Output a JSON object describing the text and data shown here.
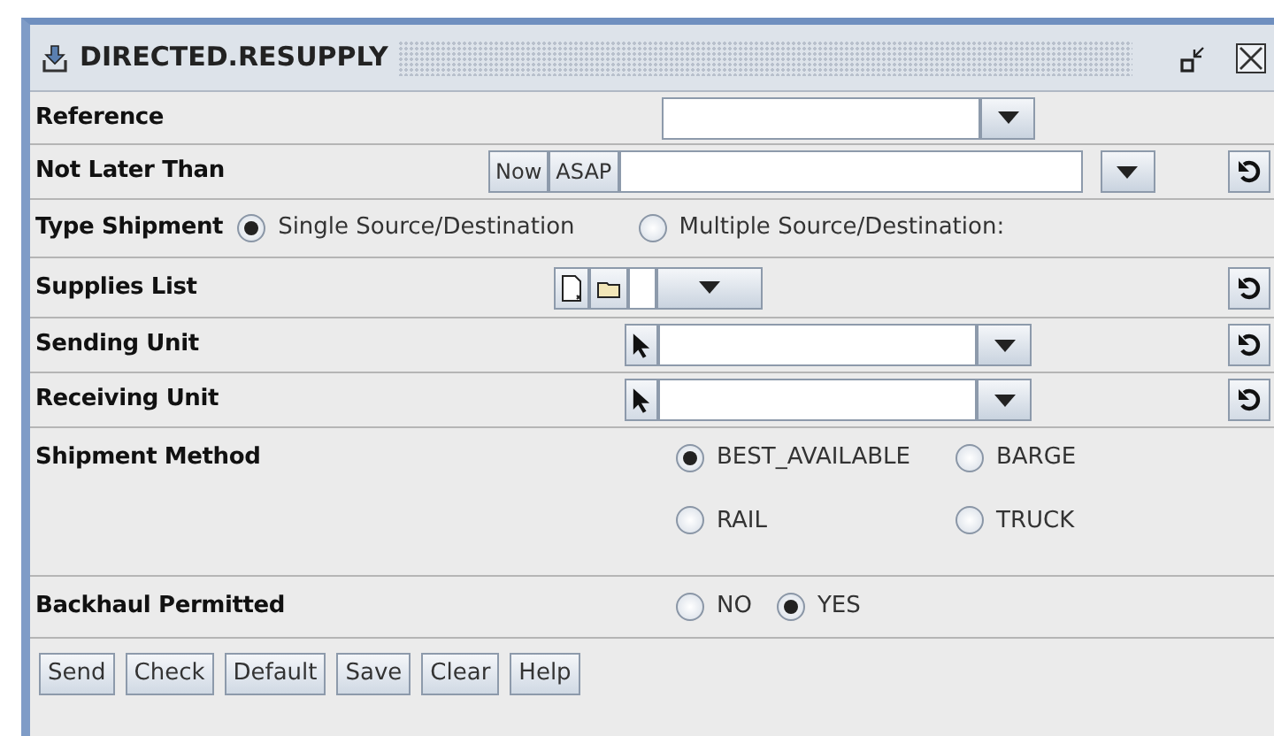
{
  "window": {
    "title": "DIRECTED.RESUPPLY"
  },
  "rows": [
    {
      "kind": "combo",
      "label": "Reference",
      "reset": false
    },
    {
      "kind": "date",
      "label": "Not Later Than",
      "buttons": [
        "Now",
        "ASAP"
      ],
      "reset": true
    },
    {
      "kind": "choice-inline",
      "label": "Type Shipment",
      "options": [
        {
          "label": "Single Source/Destination",
          "selected": true
        },
        {
          "label": "Multiple Source/Destination:",
          "selected": false
        }
      ]
    },
    {
      "kind": "file",
      "label": "Supplies List",
      "reset": true
    },
    {
      "kind": "pick",
      "label": "Sending Unit",
      "reset": true
    },
    {
      "kind": "pick",
      "label": "Receiving Unit",
      "reset": true
    },
    {
      "kind": "choice-grid",
      "label": "Shipment Method",
      "options": [
        {
          "label": "BEST_AVAILABLE",
          "selected": true
        },
        {
          "label": "BARGE",
          "selected": false
        },
        {
          "label": "RAIL",
          "selected": false
        },
        {
          "label": "TRUCK",
          "selected": false
        }
      ]
    },
    {
      "kind": "choice",
      "label": "Backhaul Permitted",
      "options": [
        {
          "label": "NO",
          "selected": false
        },
        {
          "label": "YES",
          "selected": true
        }
      ]
    }
  ],
  "buttons": [
    "Send",
    "Check",
    "Default",
    "Save",
    "Clear",
    "Help"
  ]
}
